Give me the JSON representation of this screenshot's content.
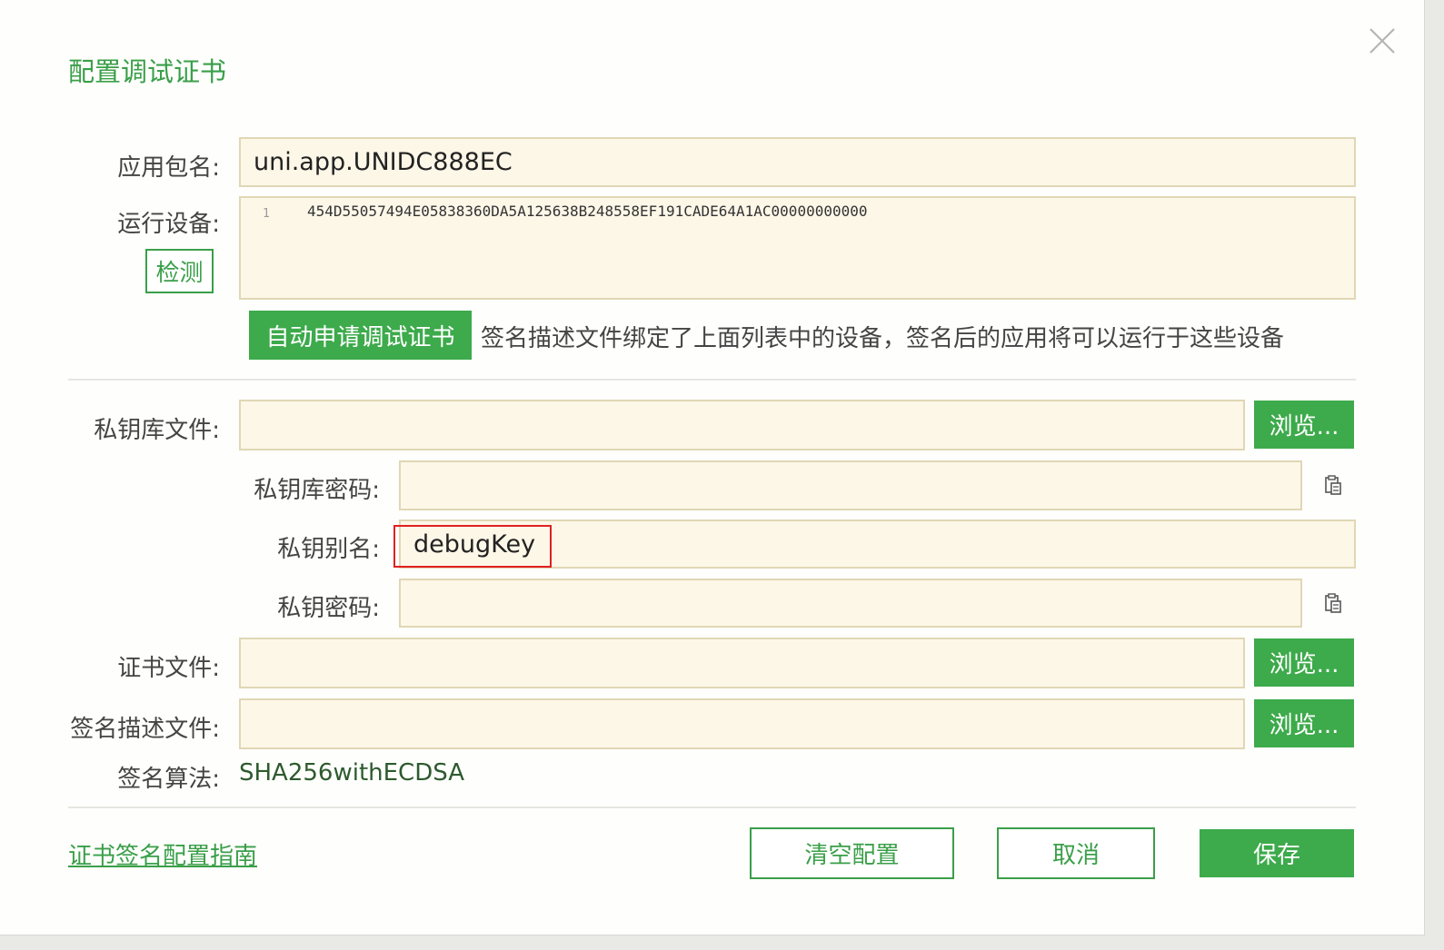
{
  "dialog": {
    "title": "配置调试证书",
    "close_icon": "close-icon"
  },
  "package": {
    "label": "应用包名:",
    "value": "uni.app.UNIDC888EC"
  },
  "devices": {
    "label": "运行设备:",
    "detect_button": "检测",
    "lines": [
      {
        "number": "1",
        "text": "454D55057494E05838360DA5A125638B248558EF191CADE64A1AC00000000000"
      }
    ]
  },
  "auto_request": {
    "button": "自动申请调试证书",
    "hint": "签名描述文件绑定了上面列表中的设备，签名后的应用将可以运行于这些设备"
  },
  "keystore": {
    "label": "私钥库文件:",
    "value": "",
    "browse": "浏览..."
  },
  "keystore_password": {
    "label": "私钥库密码:",
    "value": "",
    "paste_icon": "clipboard-icon"
  },
  "key_alias": {
    "label": "私钥别名:",
    "value": "debugKey"
  },
  "key_password": {
    "label": "私钥密码:",
    "value": "",
    "paste_icon": "clipboard-icon"
  },
  "certificate": {
    "label": "证书文件:",
    "value": "",
    "browse": "浏览..."
  },
  "profile": {
    "label": "签名描述文件:",
    "value": "",
    "browse": "浏览..."
  },
  "algorithm": {
    "label": "签名算法:",
    "value": "SHA256withECDSA"
  },
  "footer": {
    "guide_link": "证书签名配置指南",
    "clear_button": "清空配置",
    "cancel_button": "取消",
    "save_button": "保存"
  },
  "colors": {
    "accent": "#3daa4b",
    "field_bg": "#fdf7e8",
    "field_border": "#e0d7b5",
    "highlight": "#e02020"
  }
}
